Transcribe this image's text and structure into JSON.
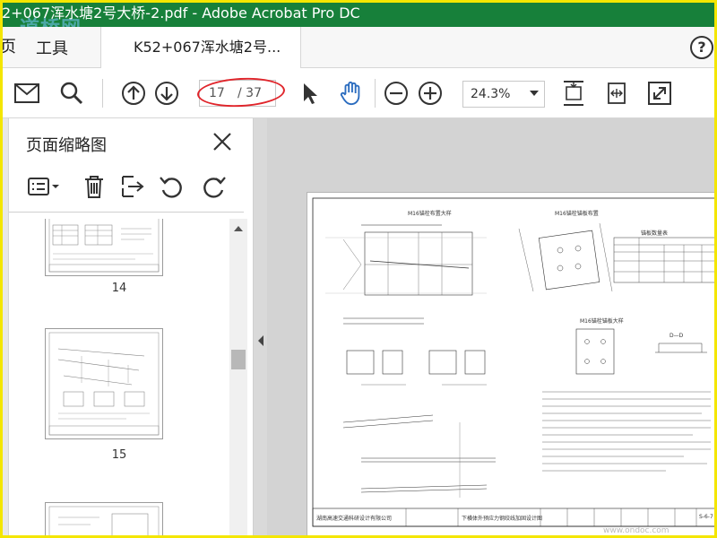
{
  "window": {
    "title": "2+067浑水塘2号大桥-2.pdf - Adobe Acrobat Pro DC",
    "watermark": "道桥网"
  },
  "tabs": {
    "left_partial": "页",
    "tools": "工具",
    "document": "K52+067浑水塘2号..."
  },
  "toolbar": {
    "page_current": "17",
    "page_total": "/ 37",
    "zoom": "24.3%"
  },
  "sidebar": {
    "title": "页面缩略图",
    "thumbnails": [
      {
        "label": "14"
      },
      {
        "label": "15"
      },
      {
        "label": ""
      }
    ]
  },
  "drawing": {
    "section_a": "M16锚栓布置大样",
    "section_b": "M16锚栓锚板布置",
    "section_c": "M16锚栓锚板大样",
    "section_d": "锚板数量表",
    "label_dd": "D—D",
    "company": "湖南高速交通科研设计有限公司",
    "project": "下横体外预应力钢绞线加固设计图",
    "drawing_no": "S-6-7",
    "footer_watermark": "www.ondoc.com"
  },
  "colors": {
    "titlebar": "#17803a",
    "frame_highlight": "#f4e600",
    "annotation_ellipse": "#e0252b",
    "acrobat_blue": "#2b6cbf"
  }
}
